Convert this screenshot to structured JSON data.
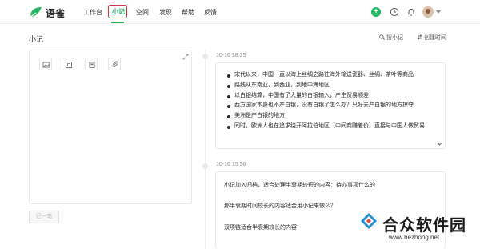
{
  "app": {
    "name": "语雀"
  },
  "nav": {
    "items": [
      "工作台",
      "小记",
      "空间",
      "发现",
      "帮助",
      "反馈"
    ],
    "active": "小记"
  },
  "toolbar": {
    "add": "+"
  },
  "page": {
    "title": "小记",
    "search_label": "搜小记",
    "sort_label": "创建时间"
  },
  "editor": {
    "tools": [
      "image-icon",
      "calendar-icon",
      "bookmark-icon",
      "attachment-icon"
    ],
    "save_label": "记一笔"
  },
  "notes": [
    {
      "time": "10-16 18:25",
      "bullets": [
        "宋代以来，中国一直以海上丝绸之路往海外输送瓷器、丝绸、茶叶等商品",
        "路线从东南亚，到西亚，到地中海地区",
        "以白银结算，中国有了大量的白银输入，产生贸易顺差",
        "西方国家本身也不产白银，没有白银了怎么办？只好去产白银的地方掠夺",
        "美洲是产白银的地方",
        "同时，欧洲人也在追求绕开阿拉伯地区（中间商赚差价）直接与中国人做贸易"
      ]
    },
    {
      "time": "10-16 15:56",
      "paragraphs": [
        "小记加入归档，适合处理半衰期较短的内容：待办事项什么的",
        "那半衰期时间较长的内容适合用小记来做么？",
        "双项链适合半衰期较长的内容"
      ]
    }
  ],
  "watermark": {
    "title": "合众软件园",
    "url": "www.hezhong.net"
  },
  "colors": {
    "brand_green": "#25b864",
    "highlight_red": "#e0343b"
  }
}
